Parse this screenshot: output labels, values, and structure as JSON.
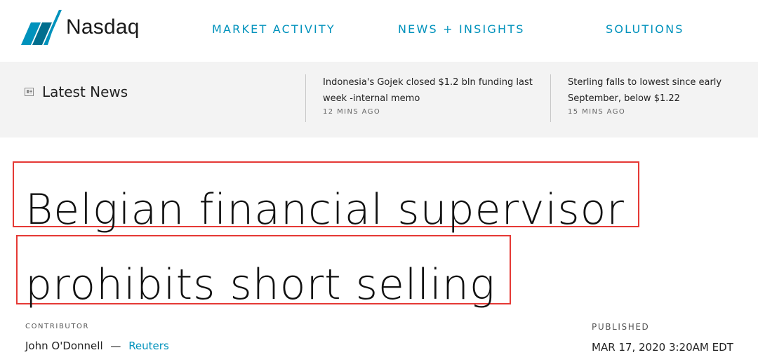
{
  "brand": {
    "name": "Nasdaq",
    "logo_color": "#0092bc"
  },
  "nav": {
    "items": [
      {
        "label": "MARKET ACTIVITY"
      },
      {
        "label": "NEWS + INSIGHTS"
      },
      {
        "label": "SOLUTIONS"
      }
    ],
    "link_color": "#0092bc"
  },
  "latest_news": {
    "label": "Latest News",
    "icon": "newspaper-icon",
    "items": [
      {
        "title": "Indonesia's Gojek closed $1.2 bln funding last week -internal memo",
        "time": "12 MINS AGO"
      },
      {
        "title": "Sterling falls to lowest since early September, below $1.22",
        "time": "15 MINS AGO"
      }
    ]
  },
  "article": {
    "headline_line1": "Belgian financial supervisor",
    "headline_line2": "prohibits short selling",
    "highlight_color": "#e53935",
    "contributor_label": "CONTRIBUTOR",
    "contributor_name": "John O'Donnell",
    "separator": "—",
    "source": "Reuters",
    "published_label": "PUBLISHED",
    "published_date": "MAR 17, 2020 3:20AM EDT"
  }
}
